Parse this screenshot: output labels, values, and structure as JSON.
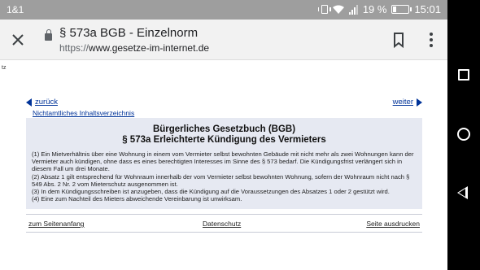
{
  "status_bar": {
    "carrier": "1&1",
    "battery_percent": "19 %",
    "battery_level": 0.19,
    "time": "15:01"
  },
  "toolbar": {
    "title": "§ 573a BGB - Einzelnorm",
    "url_scheme": "https://",
    "url_host": "www.gesetze-im-internet.de",
    "icons": [
      "close-icon",
      "lock-icon",
      "bookmark-icon",
      "overflow-menu-icon"
    ]
  },
  "page": {
    "side_fragment": "tz",
    "nav": {
      "prev_label": "zurück",
      "next_label": "weiter",
      "toc_label": "Nichtamtliches Inhaltsverzeichnis"
    },
    "heading": {
      "line1": "Bürgerliches Gesetzbuch (BGB)",
      "line2": "§ 573a Erleichterte Kündigung des Vermieters"
    },
    "paragraphs": [
      "(1) Ein Mietverhältnis über eine Wohnung in einem vom Vermieter selbst bewohnten Gebäude mit nicht mehr als zwei Wohnungen kann der Vermieter auch kündigen, ohne dass es eines berechtigten Interesses im Sinne des § 573 bedarf. Die Kündigungsfrist verlängert sich in diesem Fall um drei Monate.",
      "(2) Absatz 1 gilt entsprechend für Wohnraum innerhalb der vom Vermieter selbst bewohnten Wohnung, sofern der Wohnraum nicht nach § 549 Abs. 2 Nr. 2 vom Mieterschutz ausgenommen ist.",
      "(3) In dem Kündigungsschreiben ist anzugeben, dass die Kündigung auf die Voraussetzungen des Absatzes 1 oder 2 gestützt wird.",
      "(4) Eine zum Nachteil des Mieters abweichende Vereinbarung ist unwirksam."
    ],
    "footer": {
      "top_link": "zum Seitenanfang",
      "privacy_link": "Datenschutz",
      "print_link": "Seite ausdrucken"
    }
  },
  "system_nav": {
    "icons": [
      "recent-apps-icon",
      "home-icon",
      "back-icon"
    ]
  },
  "colors": {
    "link": "#003399",
    "content_bg": "#e6e9f2",
    "statusbar_bg": "#9e9e9e",
    "toolbar_bg": "#f2f2f2"
  }
}
